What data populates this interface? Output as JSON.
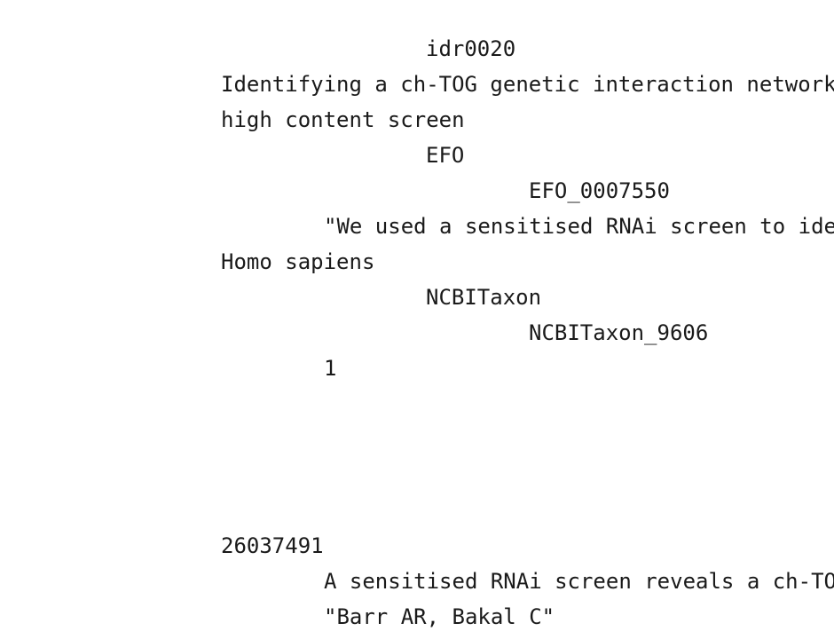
{
  "lines": [
    {
      "key": "# Study",
      "value": ""
    },
    {
      "key": "Comment[IDR Study Accession]",
      "value": "idr0020"
    },
    {
      "key": "Study Title",
      "value": "Identifying a ch-TOG genetic interaction network"
    },
    {
      "key": "Study Type",
      "value": "high content screen"
    },
    {
      "key": "Study Type Term Source REF",
      "value": "EFO"
    },
    {
      "key": "Study Type Term Accession Number",
      "value": "EFO_0007550"
    },
    {
      "key": "Study Description",
      "value": "\"We used a sensitised RNAi screen to ide"
    },
    {
      "key": "Study Organism",
      "value": "Homo sapiens"
    },
    {
      "key": "Study Organism Term Source REF",
      "value": "NCBITaxon"
    },
    {
      "key": "Study Organism Term Accession Number",
      "value": "NCBITaxon_9606"
    },
    {
      "key": "Study Screens Number",
      "value": "1"
    },
    {
      "key": "Study External URL",
      "value": ""
    },
    {
      "key": "Study Public Release Date",
      "value": ""
    },
    {
      "key": "",
      "value": ""
    },
    {
      "key": "# Study Publication",
      "value": ""
    },
    {
      "key": "Study PubMed ID",
      "value": "26037491"
    },
    {
      "key": "Study Publication Title",
      "value": "A sensitised RNAi screen reveals a ch-TO"
    },
    {
      "key": "Study Author List",
      "value": "\"Barr AR, Bakal C\""
    }
  ]
}
